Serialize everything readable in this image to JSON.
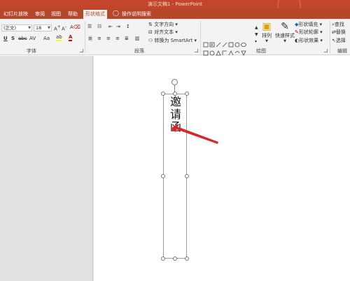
{
  "window": {
    "title": "演示文稿1 - PowerPoint"
  },
  "tabs": [
    "幻灯片放映",
    "审阅",
    "视图",
    "帮助",
    "形状格式"
  ],
  "active_tab": "形状格式",
  "tell_me": "操作说明搜索",
  "ribbon": {
    "font": {
      "name": "(正文)",
      "size": "18",
      "group_label": "字体",
      "buttons": [
        "U",
        "S",
        "abc",
        "AV",
        "Aa",
        "A"
      ]
    },
    "paragraph": {
      "text_direction": "文字方向",
      "align_text": "对齐文本",
      "convert_smartart": "转换为 SmartArt",
      "group_label": "段落"
    },
    "drawing": {
      "arrange": "排列",
      "quick_styles": "快速样式",
      "shape_fill": "形状填充",
      "shape_outline": "形状轮廓",
      "shape_effects": "形状效果",
      "group_label": "绘图"
    },
    "editing": {
      "find": "查找",
      "replace": "替换",
      "select": "选择",
      "group_label": "编辑"
    }
  },
  "slide": {
    "textbox_text": "邀请函"
  },
  "colors": {
    "brand": "#b7472a",
    "arrow": "#d9262b"
  }
}
